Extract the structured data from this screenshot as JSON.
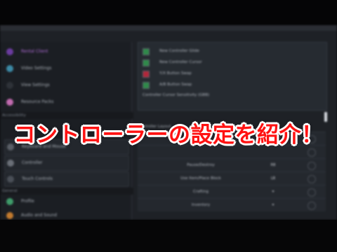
{
  "sidebar": {
    "items": [
      {
        "label": "Rental Client",
        "icon": "user-icon",
        "active": true
      },
      {
        "label": "Video Settings",
        "icon": "display-icon"
      },
      {
        "label": "View Settings",
        "icon": "eye-icon"
      },
      {
        "label": "Resource Packs",
        "icon": "pack-icon"
      }
    ],
    "groups": [
      {
        "label": "Accessibility"
      },
      {
        "label": "General"
      }
    ],
    "items_b": [
      {
        "label": "Keyboard and Mouse",
        "icon": "keyboard-icon"
      },
      {
        "label": "Controller",
        "icon": "controller-icon"
      },
      {
        "label": "Touch Controls",
        "icon": "touch-icon"
      }
    ],
    "items_c": [
      {
        "label": "Profile",
        "icon": "profile-icon"
      },
      {
        "label": "Audio and Sound",
        "icon": "sound-icon"
      }
    ]
  },
  "options": [
    {
      "label": "New Controller Glide",
      "state": "on"
    },
    {
      "label": "New Controller Cursor",
      "state": "on"
    },
    {
      "label": "Y/X Button Swap",
      "state": "red"
    },
    {
      "label": "A/B Button Swap",
      "state": "on"
    }
  ],
  "sensitivity_label": "Controller Cursor Sensitivity (GBB)",
  "layout_header": "Controller Layout",
  "layout_rows": [
    {
      "label": "",
      "key": ""
    },
    {
      "label": "",
      "key": ""
    },
    {
      "label": "Pause/Destroy",
      "key": "RB"
    },
    {
      "label": "Use Item/Place Block",
      "key": "LB"
    },
    {
      "label": "Crafting",
      "key": "✦"
    },
    {
      "label": "Inventory",
      "key": "✦"
    }
  ],
  "caption": "コントローラーの設定を紹介！",
  "colors": {
    "accent": "#b06cd8",
    "caption": "#ff1212",
    "checked": "#2f8a4a"
  }
}
